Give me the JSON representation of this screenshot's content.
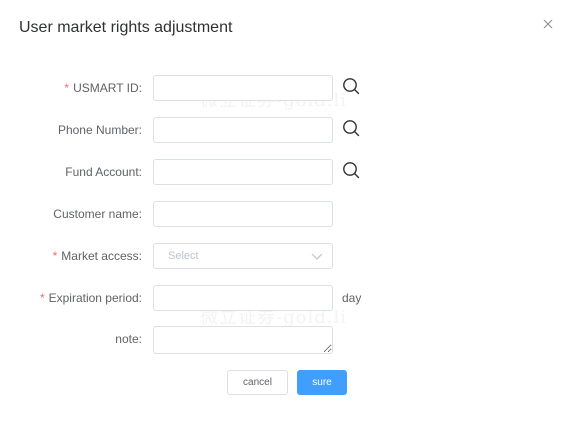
{
  "dialog": {
    "title": "User market rights adjustment"
  },
  "form": {
    "required_marker": "*",
    "usmart_id": {
      "label": "USMART ID:",
      "value": "",
      "placeholder": ""
    },
    "phone_number": {
      "label": "Phone Number:",
      "value": "",
      "placeholder": ""
    },
    "fund_account": {
      "label": "Fund Account:",
      "value": "",
      "placeholder": ""
    },
    "customer_name": {
      "label": "Customer name:",
      "value": "",
      "placeholder": ""
    },
    "market_access": {
      "label": "Market access:",
      "placeholder": "Select"
    },
    "expiration_period": {
      "label": "Expiration period:",
      "value": "",
      "unit": "day"
    },
    "note": {
      "label": "note:",
      "value": ""
    }
  },
  "buttons": {
    "cancel": "cancel",
    "sure": "sure"
  },
  "watermark": "微立证券-gold.li",
  "icons": {
    "close": "close-icon",
    "search": "search-icon",
    "select_arrow": "chevron-down-icon"
  },
  "colors": {
    "primary": "#409eff",
    "required": "#f56c6c",
    "border": "#dcdfe6",
    "placeholder": "#c0c4cc",
    "label": "#606266",
    "title": "#303133"
  }
}
